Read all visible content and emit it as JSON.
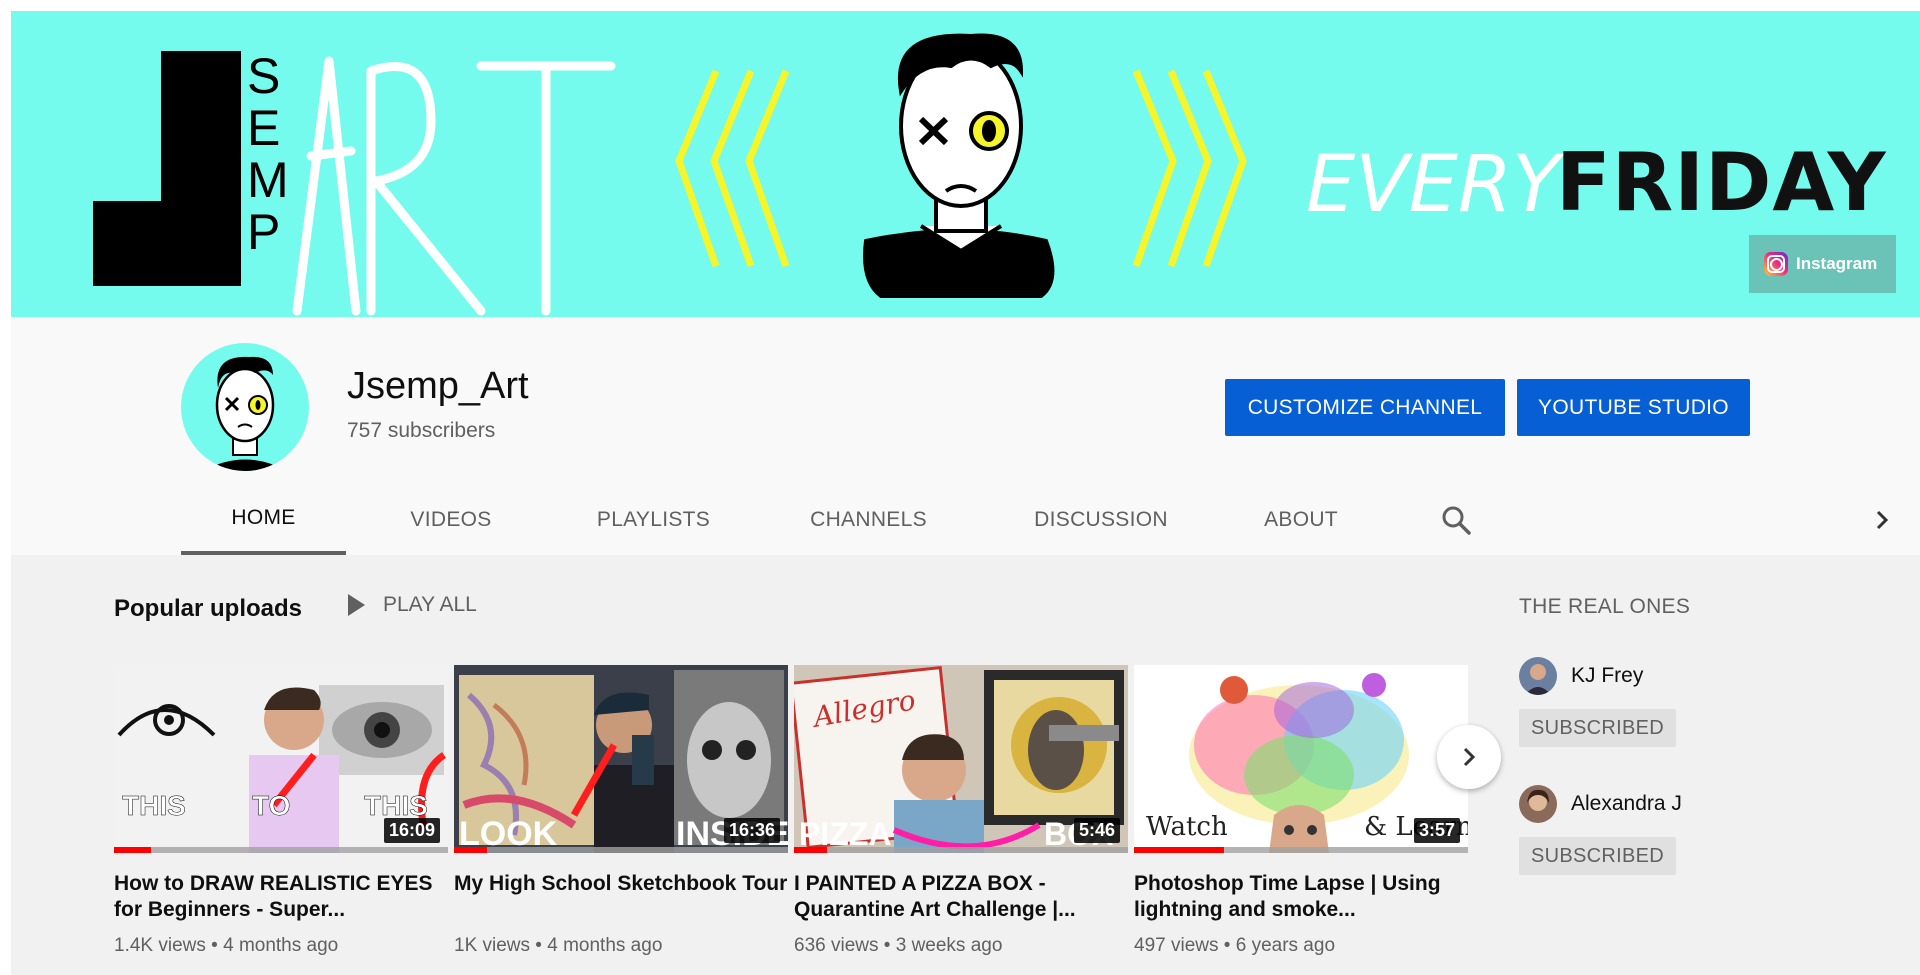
{
  "banner": {
    "logo_letter": "J",
    "logo_vertical": "SEMP",
    "logo_word": "ART",
    "tagline_script": "EVERY",
    "tagline_bold": "FRIDAY",
    "instagram_label": "Instagram"
  },
  "channel": {
    "name": "Jsemp_Art",
    "subscribers": "757 subscribers",
    "customize_label": "CUSTOMIZE CHANNEL",
    "studio_label": "YOUTUBE STUDIO"
  },
  "tabs": [
    {
      "label": "HOME",
      "active": true
    },
    {
      "label": "VIDEOS",
      "active": false
    },
    {
      "label": "PLAYLISTS",
      "active": false
    },
    {
      "label": "CHANNELS",
      "active": false
    },
    {
      "label": "DISCUSSION",
      "active": false
    },
    {
      "label": "ABOUT",
      "active": false
    }
  ],
  "section": {
    "title": "Popular uploads",
    "play_all": "PLAY ALL"
  },
  "videos": [
    {
      "title": "How to DRAW REALISTIC EYES for Beginners - Super...",
      "views": "1.4K views",
      "age": "4 months ago",
      "duration": "16:09",
      "thumb_text_left": "THIS",
      "thumb_text_mid": "TO",
      "thumb_text_right": "THIS",
      "watched_fraction": 0.11
    },
    {
      "title": "My High School Sketchbook Tour",
      "views": "1K views",
      "age": "4 months ago",
      "duration": "16:36",
      "thumb_text_left": "LOOK",
      "thumb_text_right": "INSIDE",
      "watched_fraction": 0.1
    },
    {
      "title": "I PAINTED A PIZZA BOX - Quarantine Art Challenge |...",
      "views": "636 views",
      "age": "3 weeks ago",
      "duration": "5:46",
      "thumb_text_left": "PIZZA",
      "thumb_text_right": "BOX",
      "thumb_sign": "Allegro",
      "watched_fraction": 0.1
    },
    {
      "title": "Photoshop Time Lapse | Using lightning and smoke...",
      "views": "497 views",
      "age": "6 years ago",
      "duration": "3:57",
      "thumb_text_left": "Watch",
      "thumb_text_right": "& Learn",
      "watched_fraction": 0.27
    }
  ],
  "sidebar": {
    "title": "THE REAL ONES",
    "channels": [
      {
        "name": "KJ Frey",
        "button": "SUBSCRIBED"
      },
      {
        "name": "Alexandra J",
        "button": "SUBSCRIBED"
      }
    ]
  },
  "colors": {
    "banner_bg": "#74fbee",
    "accent_blue": "#065fd4",
    "progress_red": "#ff0000",
    "chevron_yellow": "#f5f52a"
  },
  "icons": {
    "search": "search-icon",
    "next": "chevron-right-icon",
    "play": "play-icon",
    "instagram": "instagram-icon"
  }
}
